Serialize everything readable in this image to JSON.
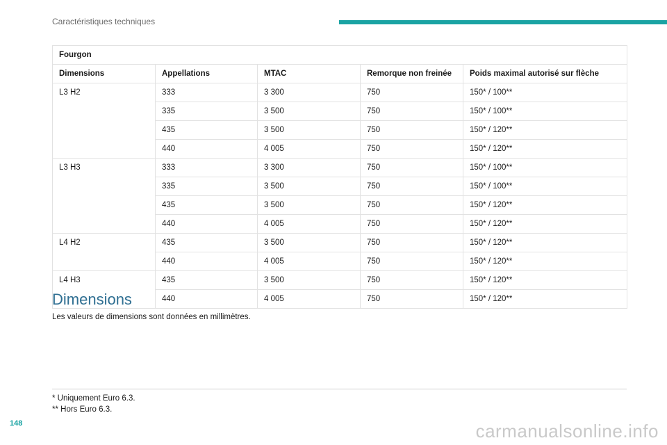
{
  "header": {
    "section_title": "Caractéristiques techniques",
    "accent_color": "#1aa3a3"
  },
  "table": {
    "caption": "Fourgon",
    "columns": [
      "Dimensions",
      "Appellations",
      "MTAC",
      "Remorque non freinée",
      "Poids maximal autorisé sur flèche"
    ],
    "groups": [
      {
        "dimension": "L3 H2",
        "rows": [
          [
            "333",
            "3 300",
            "750",
            "150* / 100**"
          ],
          [
            "335",
            "3 500",
            "750",
            "150* / 100**"
          ],
          [
            "435",
            "3 500",
            "750",
            "150* / 120**"
          ],
          [
            "440",
            "4 005",
            "750",
            "150* / 120**"
          ]
        ]
      },
      {
        "dimension": "L3 H3",
        "rows": [
          [
            "333",
            "3 300",
            "750",
            "150* / 100**"
          ],
          [
            "335",
            "3 500",
            "750",
            "150* / 100**"
          ],
          [
            "435",
            "3 500",
            "750",
            "150* / 120**"
          ],
          [
            "440",
            "4 005",
            "750",
            "150* / 120**"
          ]
        ]
      },
      {
        "dimension": "L4 H2",
        "rows": [
          [
            "435",
            "3 500",
            "750",
            "150* / 120**"
          ],
          [
            "440",
            "4 005",
            "750",
            "150* / 120**"
          ]
        ]
      },
      {
        "dimension": "L4 H3",
        "rows": [
          [
            "435",
            "3 500",
            "750",
            "150* / 120**"
          ],
          [
            "440",
            "4 005",
            "750",
            "150* / 120**"
          ]
        ]
      }
    ]
  },
  "dimensions_section": {
    "heading": "Dimensions",
    "heading_color": "#2f6f92",
    "intro": "Les valeurs de dimensions sont données en millimètres."
  },
  "footnotes": [
    "* Uniquement Euro 6.3.",
    "** Hors Euro 6.3."
  ],
  "page_number": "148",
  "watermark": "carmanualsonline.info"
}
